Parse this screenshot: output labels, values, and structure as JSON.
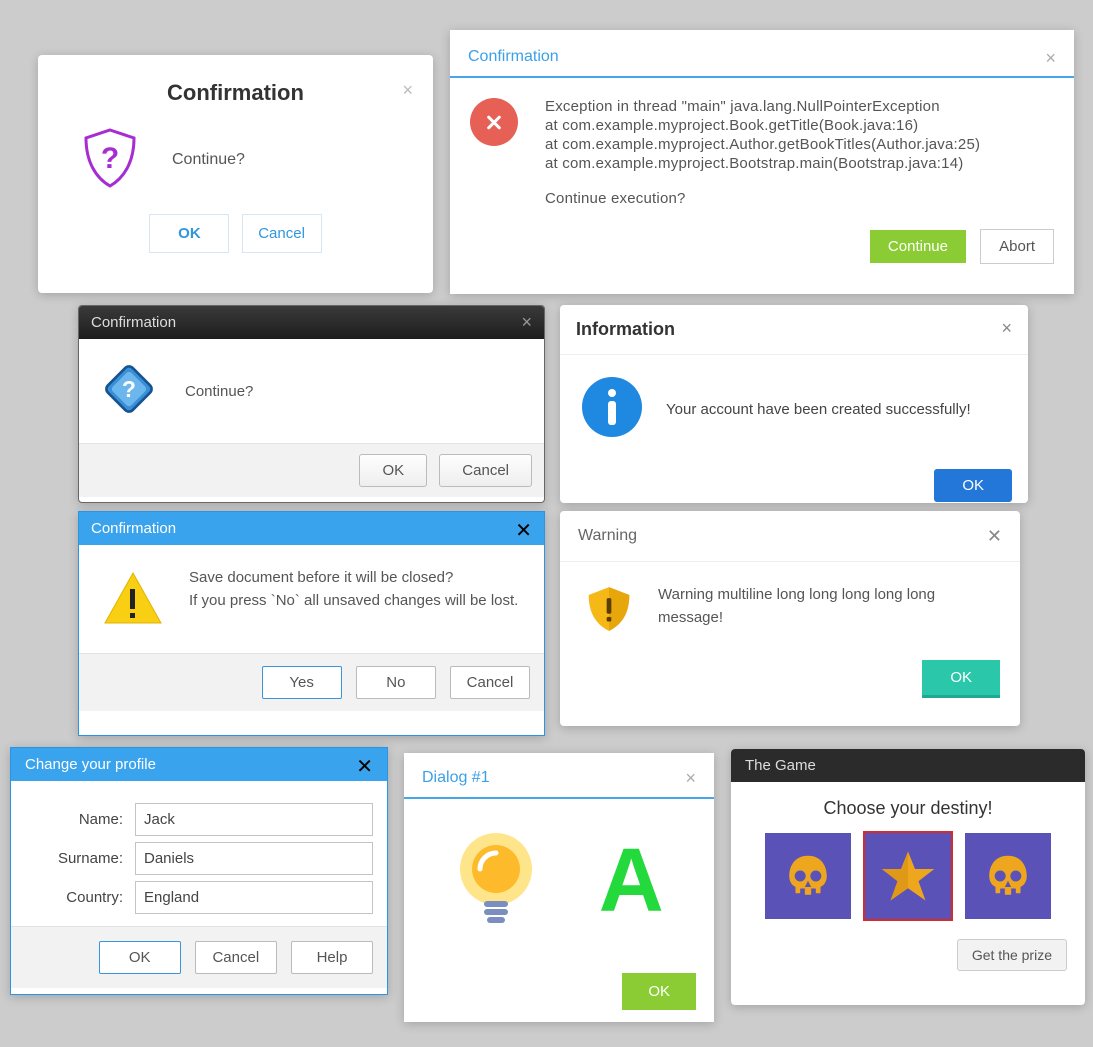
{
  "d1": {
    "title": "Confirmation",
    "message": "Continue?",
    "ok": "OK",
    "cancel": "Cancel"
  },
  "d2": {
    "title": "Confirmation",
    "line1": "Exception in thread \"main\" java.lang.NullPointerException",
    "line2": "at com.example.myproject.Book.getTitle(Book.java:16)",
    "line3": "at com.example.myproject.Author.getBookTitles(Author.java:25)",
    "line4": "at com.example.myproject.Bootstrap.main(Bootstrap.java:14)",
    "prompt": "Continue execution?",
    "continue": "Continue",
    "abort": "Abort"
  },
  "d3": {
    "title": "Confirmation",
    "message": "Continue?",
    "ok": "OK",
    "cancel": "Cancel"
  },
  "d4": {
    "title": "Information",
    "message": "Your account have been created successfully!",
    "ok": "OK"
  },
  "d5": {
    "title": "Confirmation",
    "line1": "Save document before it will be closed?",
    "line2": "If you press `No` all unsaved changes will be lost.",
    "yes": "Yes",
    "no": "No",
    "cancel": "Cancel"
  },
  "d6": {
    "title": "Warning",
    "message": "Warning multiline long long long long long message!",
    "ok": "OK"
  },
  "d7": {
    "title": "Change your profile",
    "name_label": "Name:",
    "surname_label": "Surname:",
    "country_label": "Country:",
    "name": "Jack",
    "surname": "Daniels",
    "country": "England",
    "ok": "OK",
    "cancel": "Cancel",
    "help": "Help"
  },
  "d8": {
    "title": "Dialog #1",
    "letter": "A",
    "ok": "OK"
  },
  "d9": {
    "title": "The Game",
    "subtitle": "Choose your destiny!",
    "prize": "Get the prize"
  }
}
